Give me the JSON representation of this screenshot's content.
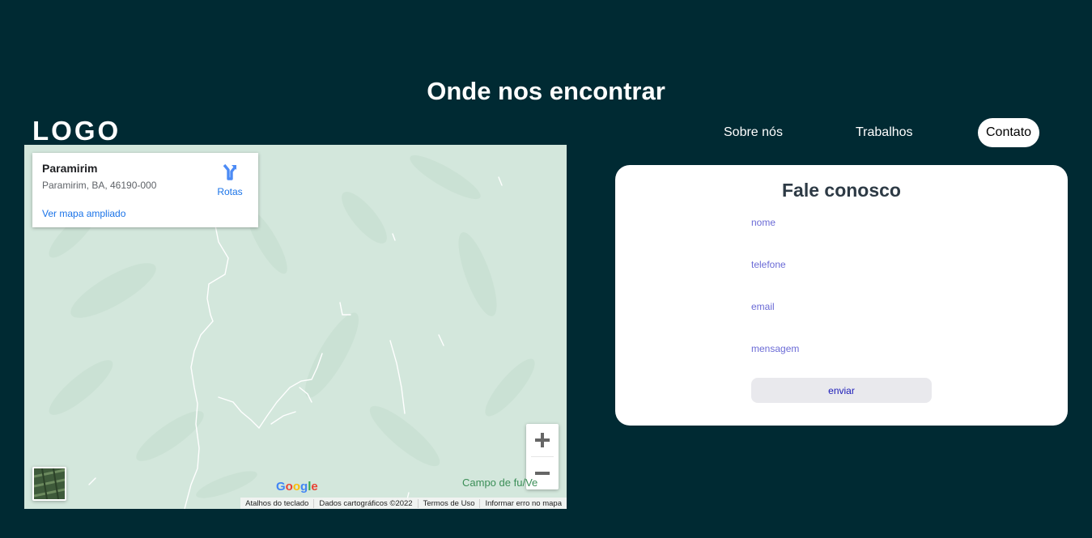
{
  "section": {
    "title": "Onde nos encontrar"
  },
  "brand": {
    "logo": "LOGO"
  },
  "nav": {
    "items": [
      {
        "label": "Sobre nós"
      },
      {
        "label": "Trabalhos"
      },
      {
        "label": "Contato",
        "active": true
      }
    ]
  },
  "map": {
    "place_name": "Paramirim",
    "place_address": "Paramirim, BA, 46190-000",
    "directions_label": "Rotas",
    "directions_icon": "directions-icon",
    "larger_map_link": "Ver mapa ampliado",
    "zoom_in_icon": "plus-icon",
    "zoom_out_icon": "minus-icon",
    "layer_icon": "satellite-layer-thumbnail",
    "place_label": "Campo de fu",
    "place_label_tail": "Ve",
    "provider_logo": "Google",
    "attribution": [
      "Atalhos do teclado",
      "Dados cartográficos ©2022",
      "Termos de Uso",
      "Informar erro no mapa"
    ],
    "colors": {
      "land": "#d3e7dc",
      "link": "#1a73e8",
      "label": "#3b8e57"
    }
  },
  "contact": {
    "title": "Fale conosco",
    "fields": {
      "name_placeholder": "nome",
      "phone_placeholder": "telefone",
      "email_placeholder": "email",
      "message_placeholder": "mensagem"
    },
    "submit_label": "enviar"
  },
  "colors": {
    "background": "#002a33",
    "card": "#ffffff",
    "accent": "#6b6bd6"
  }
}
